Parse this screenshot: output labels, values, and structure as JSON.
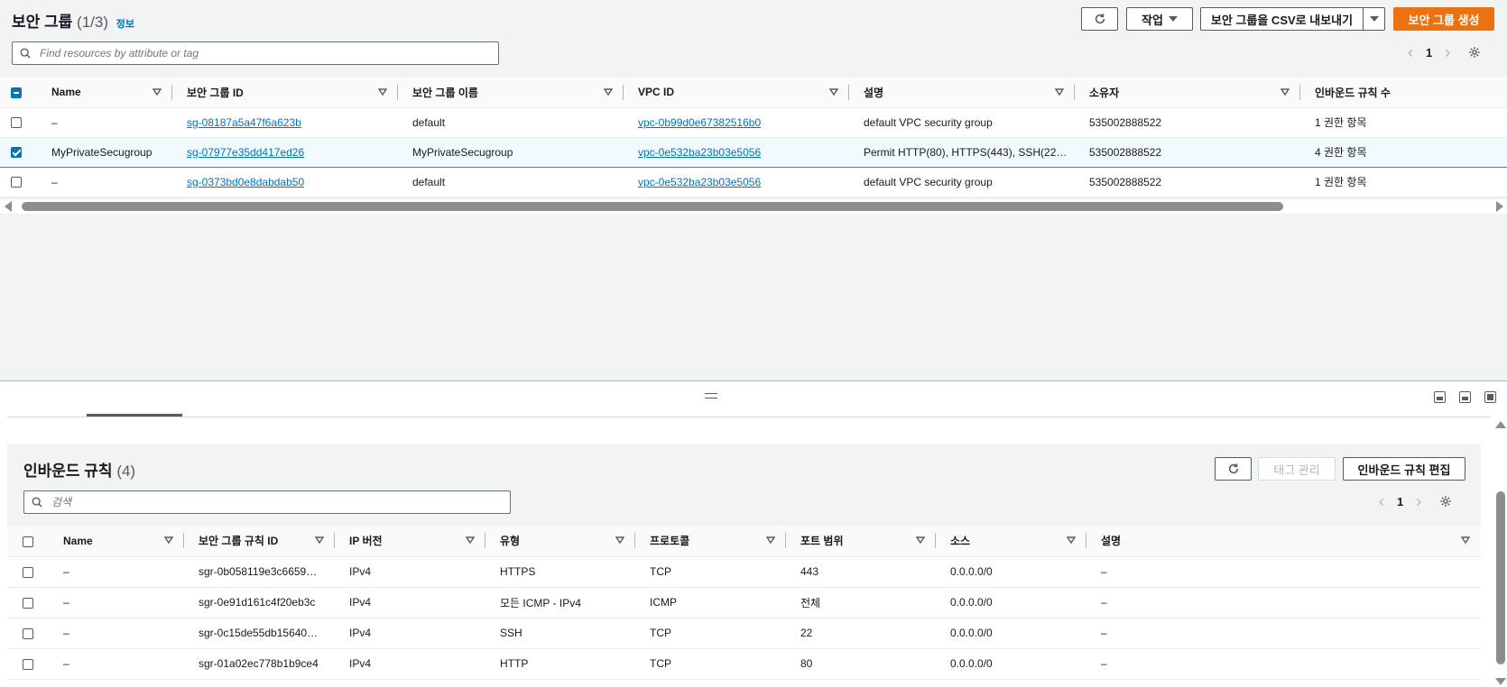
{
  "header": {
    "title": "보안 그룹",
    "count": "(1/3)",
    "info": "정보",
    "refresh_icon": "refresh-icon",
    "actions_label": "작업",
    "export_label": "보안 그룹을 CSV로 내보내기",
    "create_label": "보안 그룹 생성",
    "accent_color": "#ec7211"
  },
  "search": {
    "placeholder": "Find resources by attribute or tag"
  },
  "pager": {
    "page": "1"
  },
  "groups_table": {
    "columns": [
      "Name",
      "보안 그룹 ID",
      "보안 그룹 이름",
      "VPC ID",
      "설명",
      "소유자",
      "인바운드 규칙 수"
    ],
    "rows": [
      {
        "name": "–",
        "group_id": "sg-08187a5a47f6a623b",
        "group_name": "default",
        "vpc_id": "vpc-0b99d0e67382516b0",
        "description": "default VPC security group",
        "owner": "535002888522",
        "rules": "1 권한 항목",
        "selected": false
      },
      {
        "name": "MyPrivateSecugroup",
        "group_id": "sg-07977e35dd417ed26",
        "group_name": "MyPrivateSecugroup",
        "vpc_id": "vpc-0e532ba23b03e5056",
        "description": "Permit HTTP(80), HTTPS(443), SSH(22…",
        "owner": "535002888522",
        "rules": "4 권한 항목",
        "selected": true
      },
      {
        "name": "–",
        "group_id": "sg-0373bd0e8dabdab50",
        "group_name": "default",
        "vpc_id": "vpc-0e532ba23b03e5056",
        "description": "default VPC security group",
        "owner": "535002888522",
        "rules": "1 권한 항목",
        "selected": false
      }
    ]
  },
  "inbound": {
    "title": "인바운드 규칙",
    "count": "(4)",
    "manage_tags_label": "태그 관리",
    "edit_rules_label": "인바운드 규칙 편집",
    "search_placeholder": "검색",
    "page": "1",
    "columns": [
      "Name",
      "보안 그룹 규칙 ID",
      "IP 버전",
      "유형",
      "프로토콜",
      "포트 범위",
      "소스",
      "설명"
    ],
    "rows": [
      {
        "name": "–",
        "rule_id": "sgr-0b058119e3c6659…",
        "ip": "IPv4",
        "type": "HTTPS",
        "protocol": "TCP",
        "port": "443",
        "source": "0.0.0.0/0",
        "description": "–"
      },
      {
        "name": "–",
        "rule_id": "sgr-0e91d161c4f20eb3c",
        "ip": "IPv4",
        "type": "모든 ICMP - IPv4",
        "protocol": "ICMP",
        "port": "전체",
        "source": "0.0.0.0/0",
        "description": "–"
      },
      {
        "name": "–",
        "rule_id": "sgr-0c15de55db15640…",
        "ip": "IPv4",
        "type": "SSH",
        "protocol": "TCP",
        "port": "22",
        "source": "0.0.0.0/0",
        "description": "–"
      },
      {
        "name": "–",
        "rule_id": "sgr-01a02ec778b1b9ce4",
        "ip": "IPv4",
        "type": "HTTP",
        "protocol": "TCP",
        "port": "80",
        "source": "0.0.0.0/0",
        "description": "–"
      }
    ]
  }
}
